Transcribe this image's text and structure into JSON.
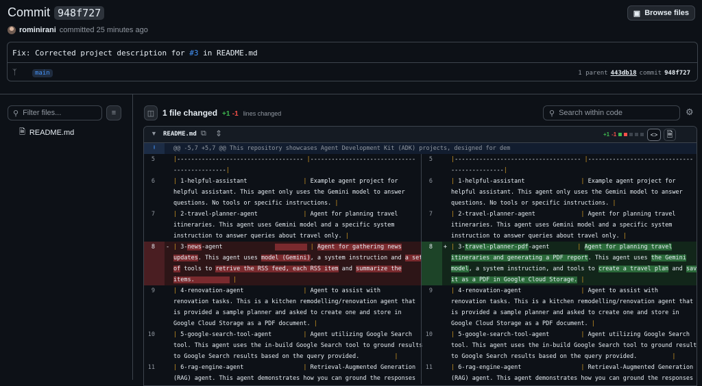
{
  "header": {
    "title_prefix": "Commit",
    "sha": "948f727",
    "browse_label": "Browse files",
    "author": "rominirani",
    "committed_text": "committed 25 minutes ago"
  },
  "message": {
    "before": "Fix: Corrected project description for ",
    "ref": "#3",
    "after": " in README.md",
    "branch": "main",
    "parent_label": "1 parent",
    "parent_sha": "443db18",
    "commit_label": "commit",
    "commit_sha": "948f727"
  },
  "sidebar": {
    "filter_placeholder": "Filter files...",
    "file": "README.md"
  },
  "toolbar": {
    "files_changed": "1 file changed",
    "additions": "+1",
    "deletions": "-1",
    "lines_changed": "lines changed",
    "search_placeholder": "Search within code"
  },
  "diff": {
    "filename": "README.md",
    "additions": "+1",
    "deletions": "-1",
    "hunk": "@@ -5,7 +5,7 @@ This repository showcases Agent Development Kit (ADK) projects, designed for dem",
    "colors": {
      "add": "#3fb950",
      "del": "#f85149",
      "neutral": "#3d444d"
    }
  }
}
